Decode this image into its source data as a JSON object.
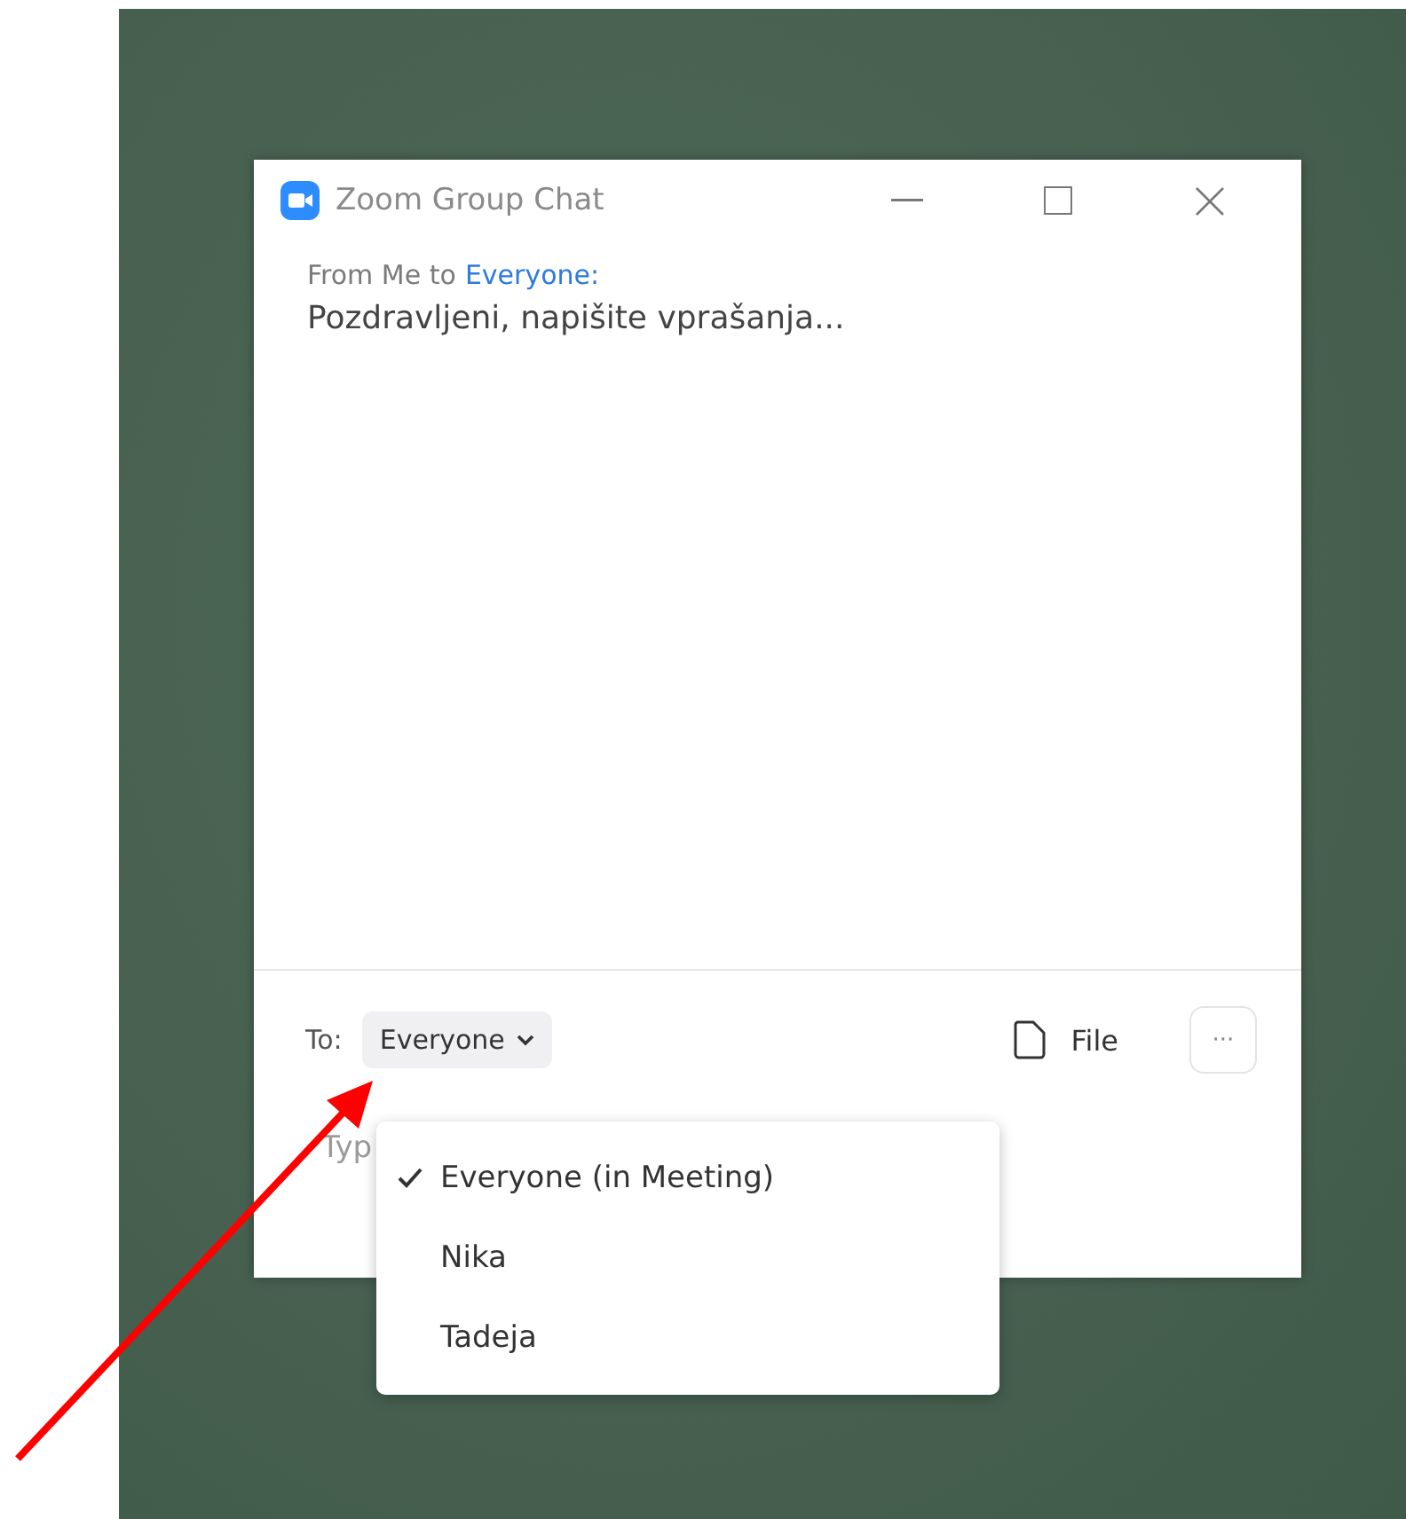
{
  "window": {
    "title": "Zoom Group Chat"
  },
  "messages": [
    {
      "sender": "From Me to",
      "recipient": "Everyone:",
      "text": "Pozdravljeni, napišite vprašanja..."
    }
  ],
  "composer": {
    "to_label": "To:",
    "recipient": "Everyone",
    "file_label": "File",
    "more_label": "···",
    "placeholder": "Typ"
  },
  "recipient_menu": [
    {
      "label": "Everyone (in Meeting)",
      "selected": true
    },
    {
      "label": "Nika",
      "selected": false
    },
    {
      "label": "Tadeja",
      "selected": false
    }
  ]
}
